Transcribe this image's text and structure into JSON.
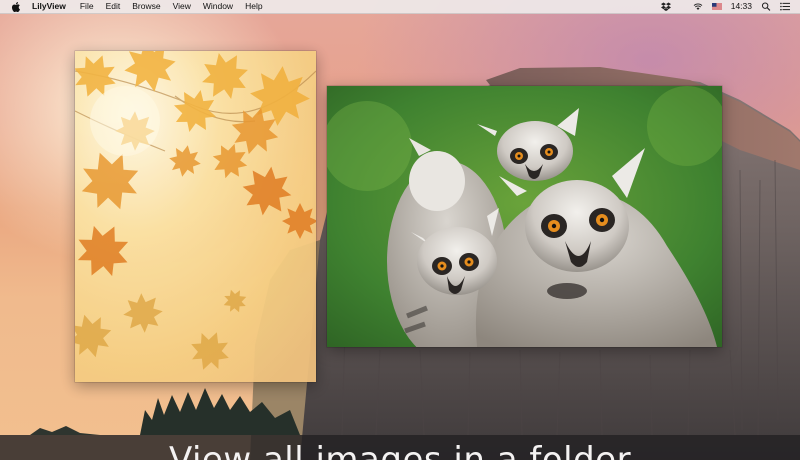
{
  "menubar": {
    "app_name": "LilyView",
    "menus": [
      "File",
      "Edit",
      "Browse",
      "View",
      "Window",
      "Help"
    ],
    "status_icons": [
      "dropbox-icon",
      "wifi-icon",
      "us-flag-icon",
      "search-icon",
      "notification-list-icon"
    ],
    "time": "14:33"
  },
  "windows": [
    {
      "name": "autumn-leaves-image",
      "content": "golden autumn leaves"
    },
    {
      "name": "lemurs-image",
      "content": "ring-tailed lemurs"
    }
  ],
  "caption": {
    "text": "View all images in a folder"
  },
  "colors": {
    "menubar": "#eee8e8",
    "caption_bar": "#232123",
    "caption_text": "#f4f2f2"
  }
}
